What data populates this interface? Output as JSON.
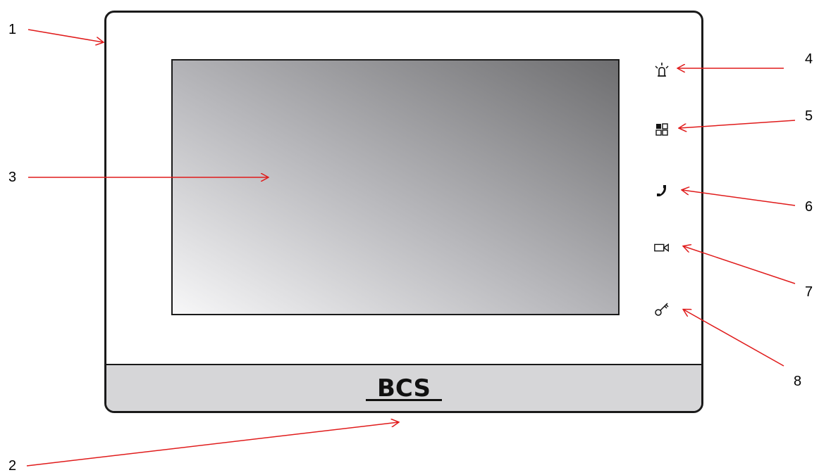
{
  "callouts": [
    {
      "number": "1",
      "target": "device-frame"
    },
    {
      "number": "2",
      "target": "bottom-panel"
    },
    {
      "number": "3",
      "target": "display-screen"
    },
    {
      "number": "4",
      "target": "alarm-button"
    },
    {
      "number": "5",
      "target": "menu-button"
    },
    {
      "number": "6",
      "target": "call-button"
    },
    {
      "number": "7",
      "target": "monitor-button"
    },
    {
      "number": "8",
      "target": "unlock-button"
    }
  ],
  "brand": {
    "logo_text": "BCS"
  },
  "buttons": [
    {
      "name": "alarm-icon"
    },
    {
      "name": "menu-grid-icon"
    },
    {
      "name": "phone-handset-icon"
    },
    {
      "name": "video-camera-icon"
    },
    {
      "name": "key-icon"
    }
  ],
  "colors": {
    "arrow": "#e01b1b",
    "frame": "#1a1a1a",
    "strip": "#d6d6d8"
  }
}
